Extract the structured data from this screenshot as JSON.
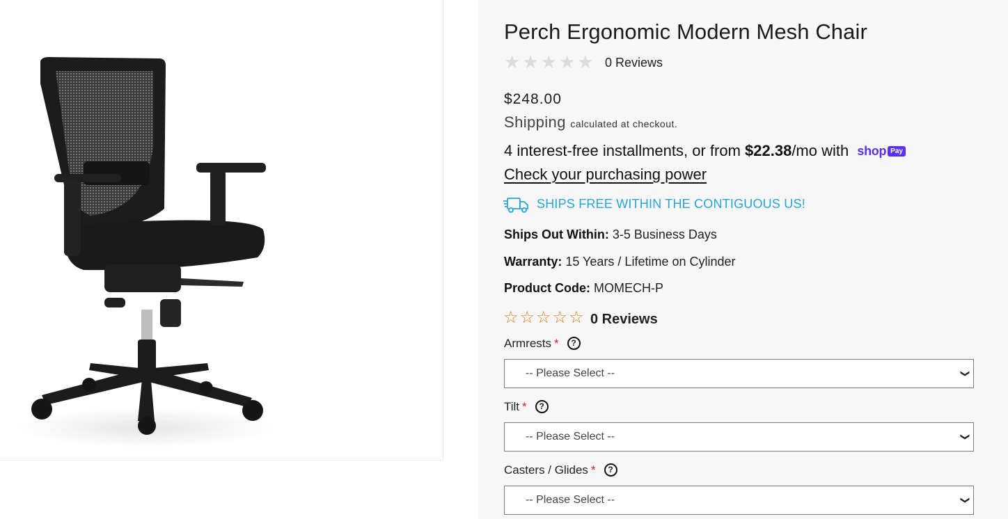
{
  "product": {
    "title": "Perch Ergonomic Modern Mesh Chair",
    "top_reviews": "0 Reviews",
    "price": "$248.00",
    "shipping_label": "Shipping",
    "shipping_note": "calculated at checkout.",
    "installments_prefix": "4 interest-free installments, or from ",
    "installments_amount": "$22.38",
    "installments_suffix": "/mo with",
    "shoppay_word": "shop",
    "shoppay_badge": "Pay",
    "purchasing_power": "Check your purchasing power",
    "ships_free": "SHIPS FREE WITHIN THE CONTIGUOUS US!",
    "rating_grey_count": 5,
    "rating_orange_count": 5,
    "reviews_orange": "0 Reviews"
  },
  "specs": [
    {
      "label": "Ships Out Within:",
      "value": " 3-5 Business Days"
    },
    {
      "label": "Warranty:",
      "value": " 15 Years / Lifetime on Cylinder"
    },
    {
      "label": "Product Code:",
      "value": " MOMECH-P"
    }
  ],
  "options": [
    {
      "label": "Armrests",
      "required": "*",
      "help": "?",
      "value": "-- Please Select --"
    },
    {
      "label": "Tilt",
      "required": "*",
      "help": "?",
      "value": "-- Please Select --"
    },
    {
      "label": "Casters / Glides",
      "required": "*",
      "help": "?",
      "value": "-- Please Select --"
    }
  ],
  "colors": {
    "accent_blue": "#27a6d4",
    "shoppay_purple": "#5a31f4",
    "star_orange": "#e57a1e",
    "required_red": "#d21e1e"
  },
  "icons": [
    "star-outline-icon",
    "truck-icon",
    "question-circle-icon",
    "chevron-down-icon"
  ]
}
